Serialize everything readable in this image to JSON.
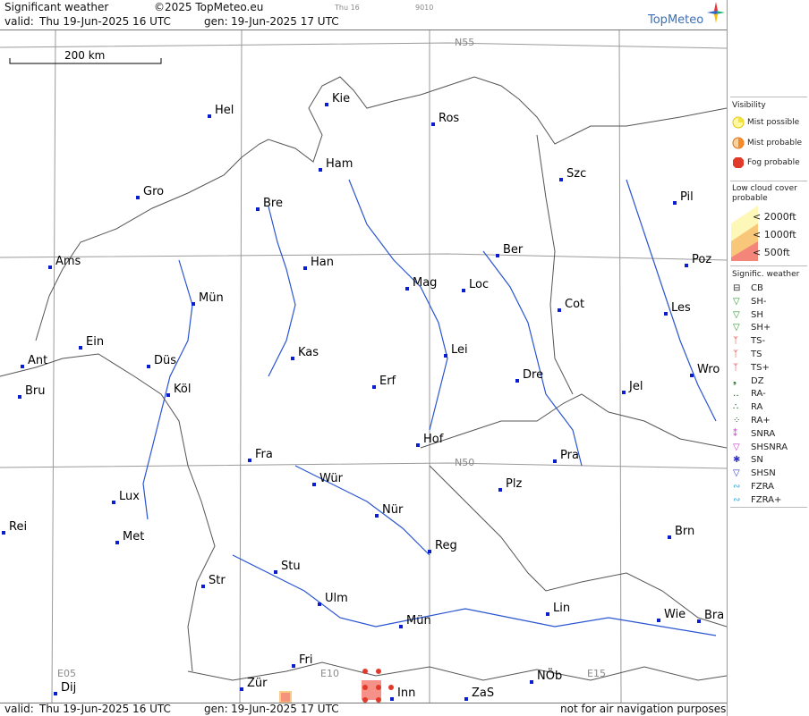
{
  "header": {
    "title": "Significant weather",
    "copyright": "©2025 TopMeteo.eu",
    "day_small": "Thu 16",
    "code_small": "9010",
    "valid_label": "valid:",
    "valid_value": "Thu  19-Jun-2025  16 UTC",
    "gen_label": "gen:",
    "gen_value": "19-Jun-2025 17 UTC",
    "brand": "TopMeteo"
  },
  "footer": {
    "valid_label": "valid:",
    "valid_value": "Thu  19-Jun-2025  16 UTC",
    "gen_label": "gen:",
    "gen_value": "19-Jun-2025 17 UTC",
    "disclaimer": "not for air navigation purposes"
  },
  "map": {
    "scale_bar": "200 km",
    "grid_labels": {
      "n55": "N55",
      "n50": "N50",
      "e05": "E05",
      "e10": "E10",
      "e15": "E15"
    },
    "cities": [
      {
        "name": "Hel"
      },
      {
        "name": "Kie"
      },
      {
        "name": "Ros"
      },
      {
        "name": "Ham"
      },
      {
        "name": "Szc"
      },
      {
        "name": "Gro"
      },
      {
        "name": "Bre"
      },
      {
        "name": "Pil"
      },
      {
        "name": "Ber"
      },
      {
        "name": "Ams"
      },
      {
        "name": "Han"
      },
      {
        "name": "Poz"
      },
      {
        "name": "Mag"
      },
      {
        "name": "Loc"
      },
      {
        "name": "Mün"
      },
      {
        "name": "Cot"
      },
      {
        "name": "Les"
      },
      {
        "name": "Ein"
      },
      {
        "name": "Kas"
      },
      {
        "name": "Lei"
      },
      {
        "name": "Ant"
      },
      {
        "name": "Düs"
      },
      {
        "name": "Dre"
      },
      {
        "name": "Wro"
      },
      {
        "name": "Erf"
      },
      {
        "name": "Bru"
      },
      {
        "name": "Köl"
      },
      {
        "name": "Jel"
      },
      {
        "name": "Hof"
      },
      {
        "name": "Fra"
      },
      {
        "name": "Pra"
      },
      {
        "name": "Wür"
      },
      {
        "name": "Plz"
      },
      {
        "name": "Lux"
      },
      {
        "name": "Rei"
      },
      {
        "name": "Nür"
      },
      {
        "name": "Met"
      },
      {
        "name": "Brn"
      },
      {
        "name": "Reg"
      },
      {
        "name": "Stu"
      },
      {
        "name": "Str"
      },
      {
        "name": "Ulm"
      },
      {
        "name": "Lin"
      },
      {
        "name": "Wie"
      },
      {
        "name": "Bra"
      },
      {
        "name": "Mün"
      },
      {
        "name": "Fri"
      },
      {
        "name": "NÖb"
      },
      {
        "name": "Dij"
      },
      {
        "name": "Zür"
      },
      {
        "name": "Inn"
      },
      {
        "name": "ZaS"
      }
    ]
  },
  "legend": {
    "visibility_title": "Visibility",
    "mist_possible": "Mist possible",
    "mist_probable": "Mist probable",
    "fog_probable": "Fog probable",
    "cloud_title_1": "Low cloud cover",
    "cloud_title_2": "probable",
    "cloud_2000": "< 2000ft",
    "cloud_1000": "< 1000ft",
    "cloud_500": "<   500ft",
    "wx_title": "Signific. weather",
    "wx": [
      "CB",
      "SH-",
      "SH",
      "SH+",
      "TS-",
      "TS",
      "TS+",
      "DZ",
      "RA-",
      "RA",
      "RA+",
      "SNRA",
      "SHSNRA",
      "SN",
      "SHSN",
      "FZRA",
      "FZRA+"
    ],
    "colors": {
      "mist_possible": "#f5e23a",
      "mist_probable": "#f28a2e",
      "fog_probable": "#e23a2a",
      "cloud_2000": "#fdf7b8",
      "cloud_1000": "#f8c77a",
      "cloud_500": "#f4857a"
    }
  }
}
